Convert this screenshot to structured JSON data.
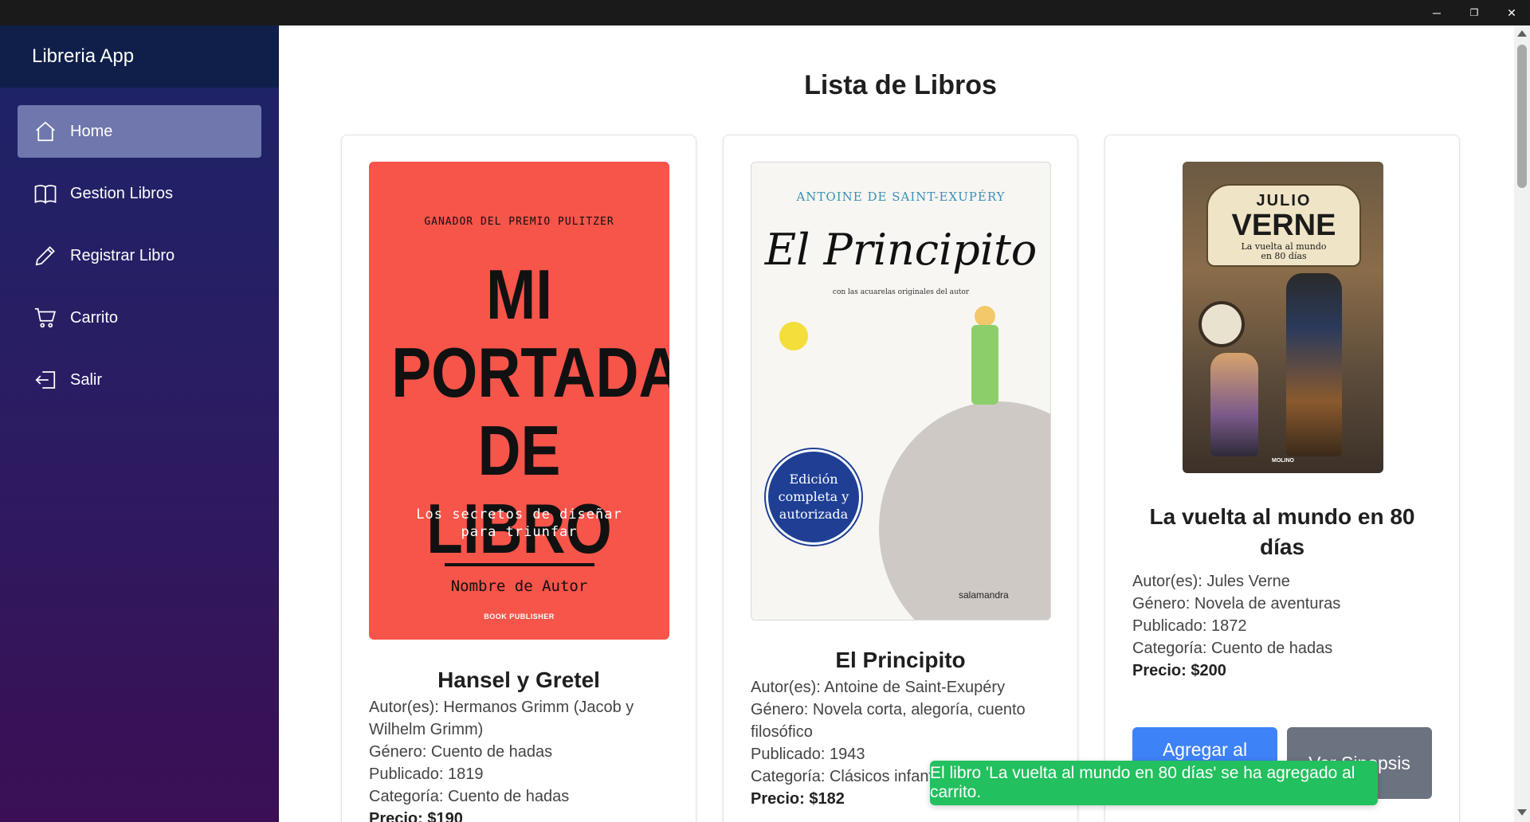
{
  "app": {
    "title": "Libreria App"
  },
  "window_controls": {
    "minimize": "─",
    "restore": "❐",
    "close": "✕"
  },
  "sidebar": {
    "items": [
      {
        "label": "Home",
        "icon": "home-icon",
        "active": true
      },
      {
        "label": "Gestion Libros",
        "icon": "book-icon",
        "active": false
      },
      {
        "label": "Registrar Libro",
        "icon": "pencil-icon",
        "active": false
      },
      {
        "label": "Carrito",
        "icon": "cart-icon",
        "active": false
      },
      {
        "label": "Salir",
        "icon": "logout-icon",
        "active": false
      }
    ]
  },
  "main": {
    "page_title": "Lista de Libros",
    "books": [
      {
        "title": "Hansel y Gretel",
        "author": "Autor(es): Hermanos Grimm (Jacob y Wilhelm Grimm)",
        "genre": "Género: Cuento de hadas",
        "published": "Publicado: 1819",
        "category": "Categoría: Cuento de hadas",
        "price": "Precio: $190",
        "cover": {
          "award": "GANADOR DEL PREMIO PULITZER",
          "headline_1": "MI",
          "headline_2": "PORTADA",
          "headline_3": "DE LIBRO",
          "subtitle_1": "Los secretos de diseñar",
          "subtitle_2": "para triunfar",
          "author_line": "Nombre de Autor",
          "publisher": "BOOK PUBLISHER"
        }
      },
      {
        "title": "El Principito",
        "author": "Autor(es): Antoine de Saint-Exupéry",
        "genre": "Género: Novela corta, alegoría, cuento filosófico",
        "published": "Publicado: 1943",
        "category": "Categoría: Clásicos infant",
        "price": "Precio: $182",
        "cover": {
          "author": "ANTOINE DE SAINT-EXUPÉRY",
          "title": "El Principito",
          "tagline": "con las acuarelas originales del autor",
          "badge_1": "Edición",
          "badge_2": "completa y",
          "badge_3": "autorizada",
          "publisher": "salamandra"
        }
      },
      {
        "title": "La vuelta al mundo en 80 días",
        "author": "Autor(es): Jules Verne",
        "genre": "Género: Novela de aventuras",
        "published": "Publicado: 1872",
        "category": "Categoría: Cuento de hadas",
        "price": "Precio: $200",
        "cover": {
          "author_1": "JULIO",
          "author_2": "VERNE",
          "title_1": "La vuelta al mundo",
          "title_2": "en 80 días",
          "publisher": "MOLINO"
        },
        "add_button": "Agregar al Carrito",
        "synopsis_button": "Ver Sinopsis"
      }
    ]
  },
  "toast": {
    "message": "El libro 'La vuelta al mundo en 80 días' se ha agregado al carrito."
  },
  "colors": {
    "sidebar_top": "#1c2368",
    "sidebar_bottom": "#3b0f55",
    "active_item": "#6f77ad",
    "primary": "#3e82f7",
    "secondary": "#6b7280",
    "toast": "#22c05e"
  }
}
